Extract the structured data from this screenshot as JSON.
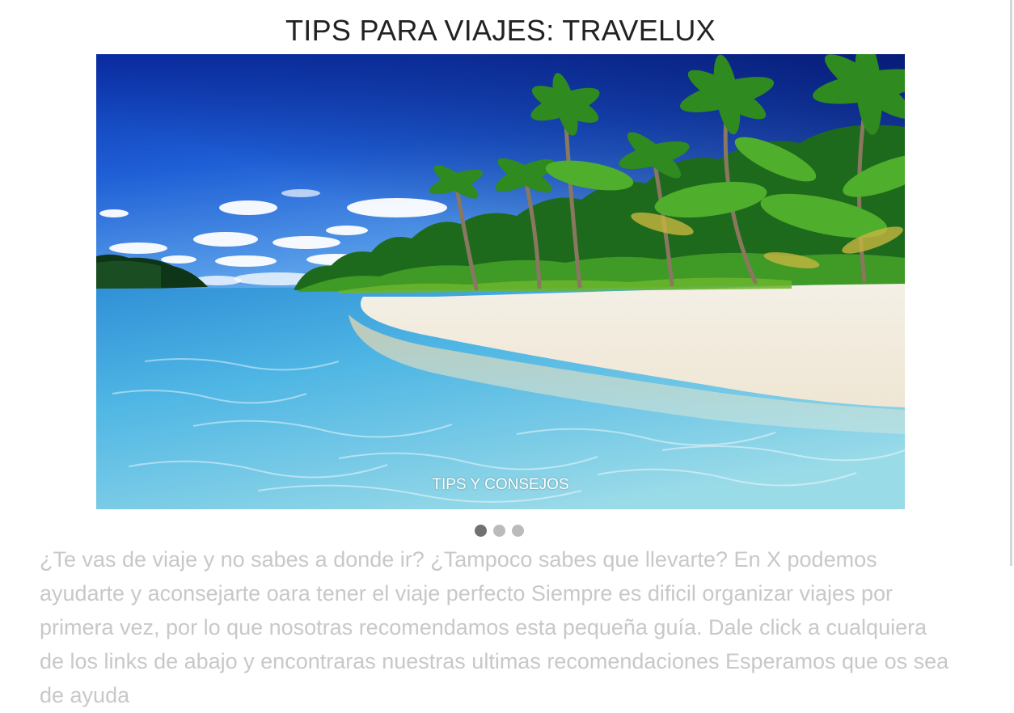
{
  "header": {
    "title": "TIPS PARA VIAJES: TRAVELUX"
  },
  "slideshow": {
    "slides": [
      {
        "caption": "TIPS Y CONSEJOS",
        "image": "tropical-beach-palm-trees"
      }
    ],
    "active_index": 0,
    "dot_count": 3
  },
  "intro": {
    "text": "¿Te vas de viaje y no sabes a donde ir? ¿Tampoco sabes que llevarte? En X podemos ayudarte y aconsejarte oara tener el viaje perfecto Siempre es dificil organizar viajes por primera vez, por lo que nosotras recomendamos esta pequeña guía. Dale click a cualquiera de los links de abajo y encontraras nuestras ultimas recomendaciones Esperamos que os sea de ayuda"
  },
  "colors": {
    "title": "#222222",
    "intro_text": "#c8c8c8",
    "dot_active": "#717171",
    "dot_inactive": "#bbbbbb",
    "caption": "#ffffff"
  }
}
